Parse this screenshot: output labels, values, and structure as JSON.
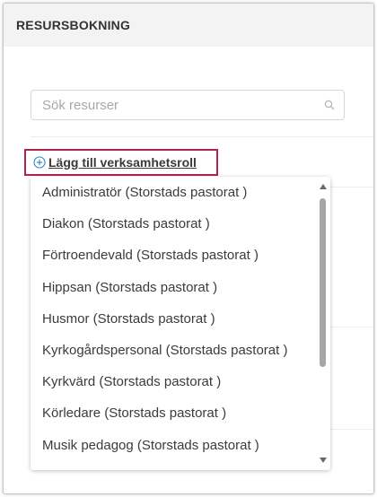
{
  "panel": {
    "title": "RESURSBOKNING"
  },
  "search": {
    "placeholder": "Sök resurser"
  },
  "add_role": {
    "label": "Lägg till verksamhetsroll"
  },
  "dropdown": {
    "options": [
      "Administratör (Storstads pastorat )",
      "Diakon (Storstads pastorat )",
      "Förtroendevald (Storstads pastorat )",
      "Hippsan (Storstads pastorat )",
      "Husmor (Storstads pastorat )",
      "Kyrkogårdspersonal (Storstads pastorat )",
      "Kyrkvärd (Storstads pastorat )",
      "Körledare (Storstads pastorat )",
      "Musik pedagog (Storstads pastorat )"
    ]
  },
  "colors": {
    "accent_border": "#b0234a",
    "add_icon": "#2e86c1",
    "header_bg": "#f3f3f3"
  },
  "icons": {
    "search": "search-icon",
    "add": "plus-circle-icon"
  }
}
